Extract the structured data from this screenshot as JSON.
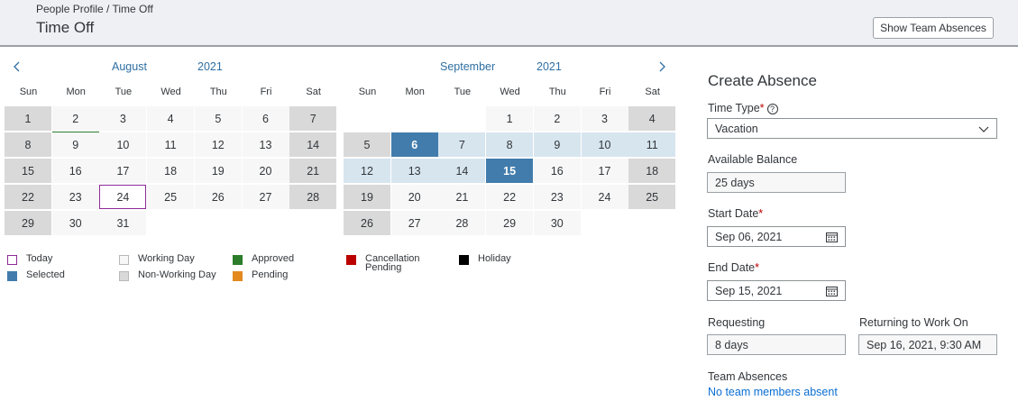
{
  "header": {
    "breadcrumb": "People Profile / Time Off",
    "title": "Time Off",
    "show_team_button": "Show Team Absences"
  },
  "calendar": {
    "days_of_week": [
      "Sun",
      "Mon",
      "Tue",
      "Wed",
      "Thu",
      "Fri",
      "Sat"
    ],
    "months": [
      {
        "month": "August",
        "year": "2021",
        "first_weekday": 0,
        "days_in_month": 31,
        "today": 24,
        "approved": [
          2
        ],
        "selected": [],
        "range": []
      },
      {
        "month": "September",
        "year": "2021",
        "first_weekday": 3,
        "days_in_month": 30,
        "today": null,
        "approved": [],
        "selected": [
          6,
          15
        ],
        "range": [
          7,
          8,
          9,
          10,
          11,
          12,
          13,
          14
        ]
      }
    ],
    "legend": [
      {
        "label": "Today",
        "kind": "today",
        "color": "#8f2a97"
      },
      {
        "label": "Selected",
        "kind": "selected",
        "color": "#427cac"
      },
      {
        "label": "Working Day",
        "kind": "working",
        "color": "#f7f7f7"
      },
      {
        "label": "Non-Working Day",
        "kind": "nonworking",
        "color": "#d9d9d9"
      },
      {
        "label": "Approved",
        "kind": "approved",
        "color": "#2b7d2b"
      },
      {
        "label": "Pending",
        "kind": "pending",
        "color": "#e38920"
      },
      {
        "label": "Cancellation Pending",
        "kind": "cancel",
        "color": "#bb0000"
      },
      {
        "label": "Holiday",
        "kind": "holiday",
        "color": "#000000"
      }
    ]
  },
  "form": {
    "title": "Create Absence",
    "time_type_label": "Time Type",
    "time_type_value": "Vacation",
    "balance_label": "Available Balance",
    "balance_value": "25 days",
    "start_label": "Start Date",
    "start_value": "Sep 06, 2021",
    "end_label": "End Date",
    "end_value": "Sep 15, 2021",
    "requesting_label": "Requesting",
    "requesting_value": "8 days",
    "returning_label": "Returning to Work On",
    "returning_value": "Sep 16, 2021, 9:30 AM",
    "team_absences_label": "Team Absences",
    "team_absences_link": "No team members absent",
    "required_mark": "*",
    "help_mark": "?"
  },
  "icons": {
    "prev": "chevron-left-icon",
    "next": "chevron-right-icon",
    "dropdown": "chevron-down-icon",
    "date_picker": "calendar-icon",
    "help": "help-icon"
  },
  "colors": {
    "accent": "#2f6fa3",
    "selected": "#427cac",
    "range": "#d7e5ef",
    "required": "#bb0000",
    "link": "#0a6ed1"
  }
}
